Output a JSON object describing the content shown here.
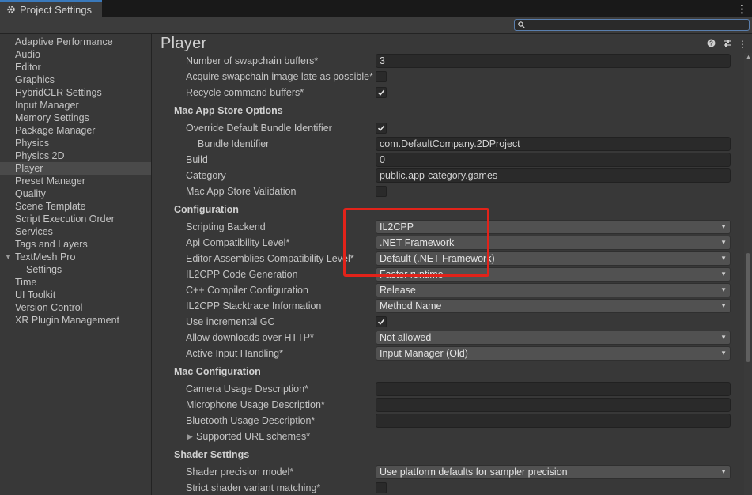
{
  "window": {
    "tab_title": "Project Settings",
    "menu_icon": "kebab-icon"
  },
  "search": {
    "placeholder": "",
    "value": ""
  },
  "sidebar": {
    "items": [
      {
        "label": "Adaptive Performance"
      },
      {
        "label": "Audio"
      },
      {
        "label": "Editor"
      },
      {
        "label": "Graphics"
      },
      {
        "label": "HybridCLR Settings"
      },
      {
        "label": "Input Manager"
      },
      {
        "label": "Memory Settings"
      },
      {
        "label": "Package Manager"
      },
      {
        "label": "Physics"
      },
      {
        "label": "Physics 2D"
      },
      {
        "label": "Player",
        "selected": true
      },
      {
        "label": "Preset Manager"
      },
      {
        "label": "Quality"
      },
      {
        "label": "Scene Template"
      },
      {
        "label": "Script Execution Order"
      },
      {
        "label": "Services"
      },
      {
        "label": "Tags and Layers"
      },
      {
        "label": "TextMesh Pro",
        "expanded": true
      },
      {
        "label": "Settings",
        "child": true
      },
      {
        "label": "Time"
      },
      {
        "label": "UI Toolkit"
      },
      {
        "label": "Version Control"
      },
      {
        "label": "XR Plugin Management"
      }
    ]
  },
  "main": {
    "title": "Player",
    "header_icons": [
      "help-icon",
      "presets-icon",
      "kebab-icon"
    ],
    "rows": [
      {
        "type": "field",
        "label": "Number of swapchain buffers*",
        "value": "3"
      },
      {
        "type": "check",
        "label": "Acquire swapchain image late as possible*",
        "checked": false
      },
      {
        "type": "check",
        "label": "Recycle command buffers*",
        "checked": true
      },
      {
        "type": "section",
        "label": "Mac App Store Options"
      },
      {
        "type": "check",
        "label": "Override Default Bundle Identifier",
        "checked": true
      },
      {
        "type": "field",
        "label": "Bundle Identifier",
        "value": "com.DefaultCompany.2DProject",
        "indent": true
      },
      {
        "type": "field",
        "label": "Build",
        "value": "0"
      },
      {
        "type": "field",
        "label": "Category",
        "value": "public.app-category.games"
      },
      {
        "type": "check",
        "label": "Mac App Store Validation",
        "checked": false
      },
      {
        "type": "section",
        "label": "Configuration"
      },
      {
        "type": "drop",
        "label": "Scripting Backend",
        "value": "IL2CPP"
      },
      {
        "type": "drop",
        "label": "Api Compatibility Level*",
        "value": ".NET Framework"
      },
      {
        "type": "drop",
        "label": "Editor Assemblies Compatibility Level*",
        "value": "Default (.NET Framework)"
      },
      {
        "type": "drop",
        "label": "IL2CPP Code Generation",
        "value": "Faster runtime"
      },
      {
        "type": "drop",
        "label": "C++ Compiler Configuration",
        "value": "Release"
      },
      {
        "type": "drop",
        "label": "IL2CPP Stacktrace Information",
        "value": "Method Name"
      },
      {
        "type": "check",
        "label": "Use incremental GC",
        "checked": true
      },
      {
        "type": "drop",
        "label": "Allow downloads over HTTP*",
        "value": "Not allowed"
      },
      {
        "type": "drop",
        "label": "Active Input Handling*",
        "value": "Input Manager (Old)"
      },
      {
        "type": "section",
        "label": "Mac Configuration"
      },
      {
        "type": "field",
        "label": "Camera Usage Description*",
        "value": ""
      },
      {
        "type": "field",
        "label": "Microphone Usage Description*",
        "value": ""
      },
      {
        "type": "field",
        "label": "Bluetooth Usage Description*",
        "value": ""
      },
      {
        "type": "fold",
        "label": "Supported URL schemes*"
      },
      {
        "type": "section",
        "label": "Shader Settings"
      },
      {
        "type": "drop",
        "label": "Shader precision model*",
        "value": "Use platform defaults for sampler precision"
      },
      {
        "type": "check",
        "label": "Strict shader variant matching*",
        "checked": false
      }
    ]
  },
  "highlight_color": "#e2231a"
}
